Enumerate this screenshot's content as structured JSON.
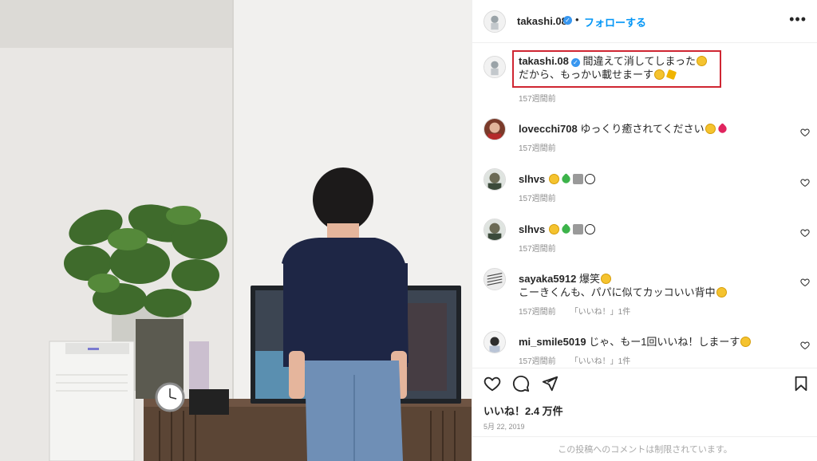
{
  "post": {
    "author": "takashi.08",
    "follow_label": "フォローする",
    "dot": "•",
    "more": "•••"
  },
  "caption": {
    "author": "takashi.08",
    "line1": "間違えて消してしまった",
    "line2": "だから、もっかい載せまーす",
    "time": "157週間前"
  },
  "comments": [
    {
      "user": "lovecchi708",
      "text": "ゆっくり癒されてください",
      "emojis": [
        "face",
        "heart"
      ],
      "time": "157週間前",
      "likes": ""
    },
    {
      "user": "slhvs",
      "text": "",
      "emojis": [
        "face",
        "green",
        "horn",
        "ball"
      ],
      "time": "157週間前",
      "likes": ""
    },
    {
      "user": "slhvs",
      "text": "",
      "emojis": [
        "face",
        "green",
        "horn",
        "ball"
      ],
      "time": "157週間前",
      "likes": ""
    },
    {
      "user": "sayaka5912",
      "text": "爆笑",
      "text2": "こーきくんも、パパに似てカッコいい背中",
      "emojis": [
        "face"
      ],
      "time": "157週間前",
      "likes": "「いいね！」1件"
    },
    {
      "user": "mi_smile5019",
      "text": "じゃ、もー1回いいね！しまーす",
      "emojis": [
        "face"
      ],
      "time": "157週間前",
      "likes": "「いいね！」1件"
    }
  ],
  "actions": {
    "like_count": "いいね！2.4 万件",
    "date": "5月 22, 2019",
    "restricted": "この投稿へのコメントは制限されています。"
  },
  "icons": {
    "like": "heart-outline-icon",
    "comment": "comment-bubble-icon",
    "share": "paper-plane-icon",
    "save": "bookmark-icon",
    "verified": "verified-badge-icon",
    "more": "more-options-icon"
  },
  "colors": {
    "follow": "#0095f6",
    "highlight": "#cf2632",
    "verified": "#3897f0",
    "meta": "#8e8e8e"
  }
}
